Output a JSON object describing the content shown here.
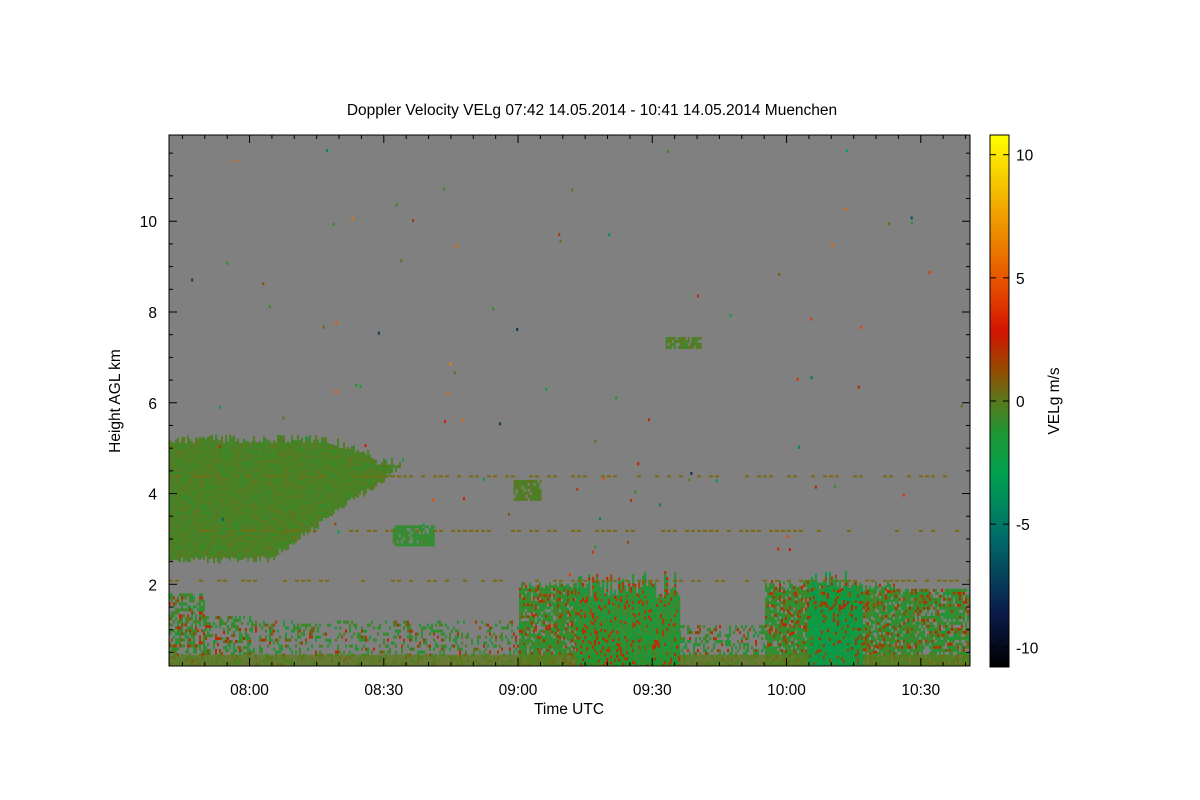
{
  "chart_data": {
    "type": "heatmap",
    "title": "Doppler Velocity VELg   07:42 14.05.2014 - 10:41 14.05.2014 Muenchen",
    "xlabel": "Time UTC",
    "ylabel": "Height AGL km",
    "colorbar_label": "VELg m/s",
    "x_ticks": [
      "08:00",
      "08:30",
      "09:00",
      "09:30",
      "10:00",
      "10:30"
    ],
    "x_tick_minutes": [
      480,
      510,
      540,
      570,
      600,
      630
    ],
    "xlim_minutes": [
      462,
      641
    ],
    "y_ticks": [
      "2",
      "4",
      "6",
      "8",
      "10"
    ],
    "y_tick_values": [
      2,
      4,
      6,
      8,
      10
    ],
    "ylim": [
      0.2,
      11.9
    ],
    "colorbar_ticks": [
      "10",
      "5",
      "0",
      "-5",
      "-10"
    ],
    "colorbar_values": [
      10,
      5,
      0,
      -5,
      -10
    ],
    "zlim": [
      -10.8,
      10.8
    ],
    "background_color": "#808080",
    "colormap": [
      "#000000",
      "#0a1a4a",
      "#006a6a",
      "#00a050",
      "#1e9632",
      "#5a781e",
      "#964a00",
      "#d21400",
      "#e65000",
      "#f0a000",
      "#ffff00"
    ],
    "echo_regions": [
      {
        "label": "mid-level cloud",
        "t_start": 462,
        "t_end": 526,
        "h_bottom": 2.5,
        "h_top": 5.3,
        "velocity": -0.6
      },
      {
        "label": "small cloud",
        "t_start": 573,
        "t_end": 581,
        "h_bottom": 7.25,
        "h_top": 7.45,
        "velocity": -0.5
      },
      {
        "label": "small cloud",
        "t_start": 539,
        "t_end": 545,
        "h_bottom": 3.9,
        "h_top": 4.3,
        "velocity": -0.3
      },
      {
        "label": "small cloud",
        "t_start": 512,
        "t_end": 521,
        "h_bottom": 2.9,
        "h_top": 3.3,
        "velocity": -1.5
      },
      {
        "label": "boundary layer",
        "t_start": 462,
        "t_end": 641,
        "h_bottom": 0.2,
        "h_top": 1.9,
        "velocity": -1.5
      },
      {
        "label": "convective plume",
        "t_start": 553,
        "t_end": 576,
        "h_bottom": 0.2,
        "h_top": 2.3,
        "velocity": -2.0
      },
      {
        "label": "convective plume",
        "t_start": 605,
        "t_end": 617,
        "h_bottom": 0.2,
        "h_top": 2.3,
        "velocity": -3.5
      }
    ]
  }
}
